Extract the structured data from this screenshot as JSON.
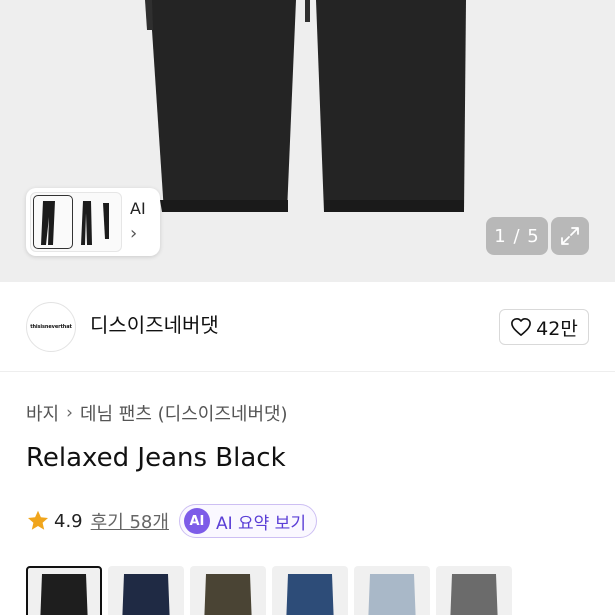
{
  "gallery": {
    "ai_label": "AI",
    "ai_chevron": "›",
    "counter": "1 / 5",
    "expand_icon": "expand-icon"
  },
  "brand": {
    "logo_text": "thisisneverthat",
    "name": "디스이즈네버댓",
    "like_icon": "heart-icon",
    "likes": "42만"
  },
  "breadcrumb": {
    "items": [
      "바지",
      "데님 팬츠 (디스이즈네버댓)"
    ],
    "separator": "›"
  },
  "product": {
    "title": "Relaxed Jeans Black",
    "rating": "4.9",
    "reviews": "후기 58개",
    "ai_badge": "AI",
    "ai_summary": "AI 요약 보기"
  },
  "colors": {
    "swatches": [
      {
        "name": "black",
        "color": "#1e1e1e",
        "selected": true
      },
      {
        "name": "navy",
        "color": "#1f2a44",
        "selected": false
      },
      {
        "name": "brown",
        "color": "#4a4434",
        "selected": false
      },
      {
        "name": "blue",
        "color": "#2d4c78",
        "selected": false
      },
      {
        "name": "light-blue",
        "color": "#a9b8c8",
        "selected": false
      },
      {
        "name": "grey",
        "color": "#6b6b6b",
        "selected": false
      }
    ]
  }
}
